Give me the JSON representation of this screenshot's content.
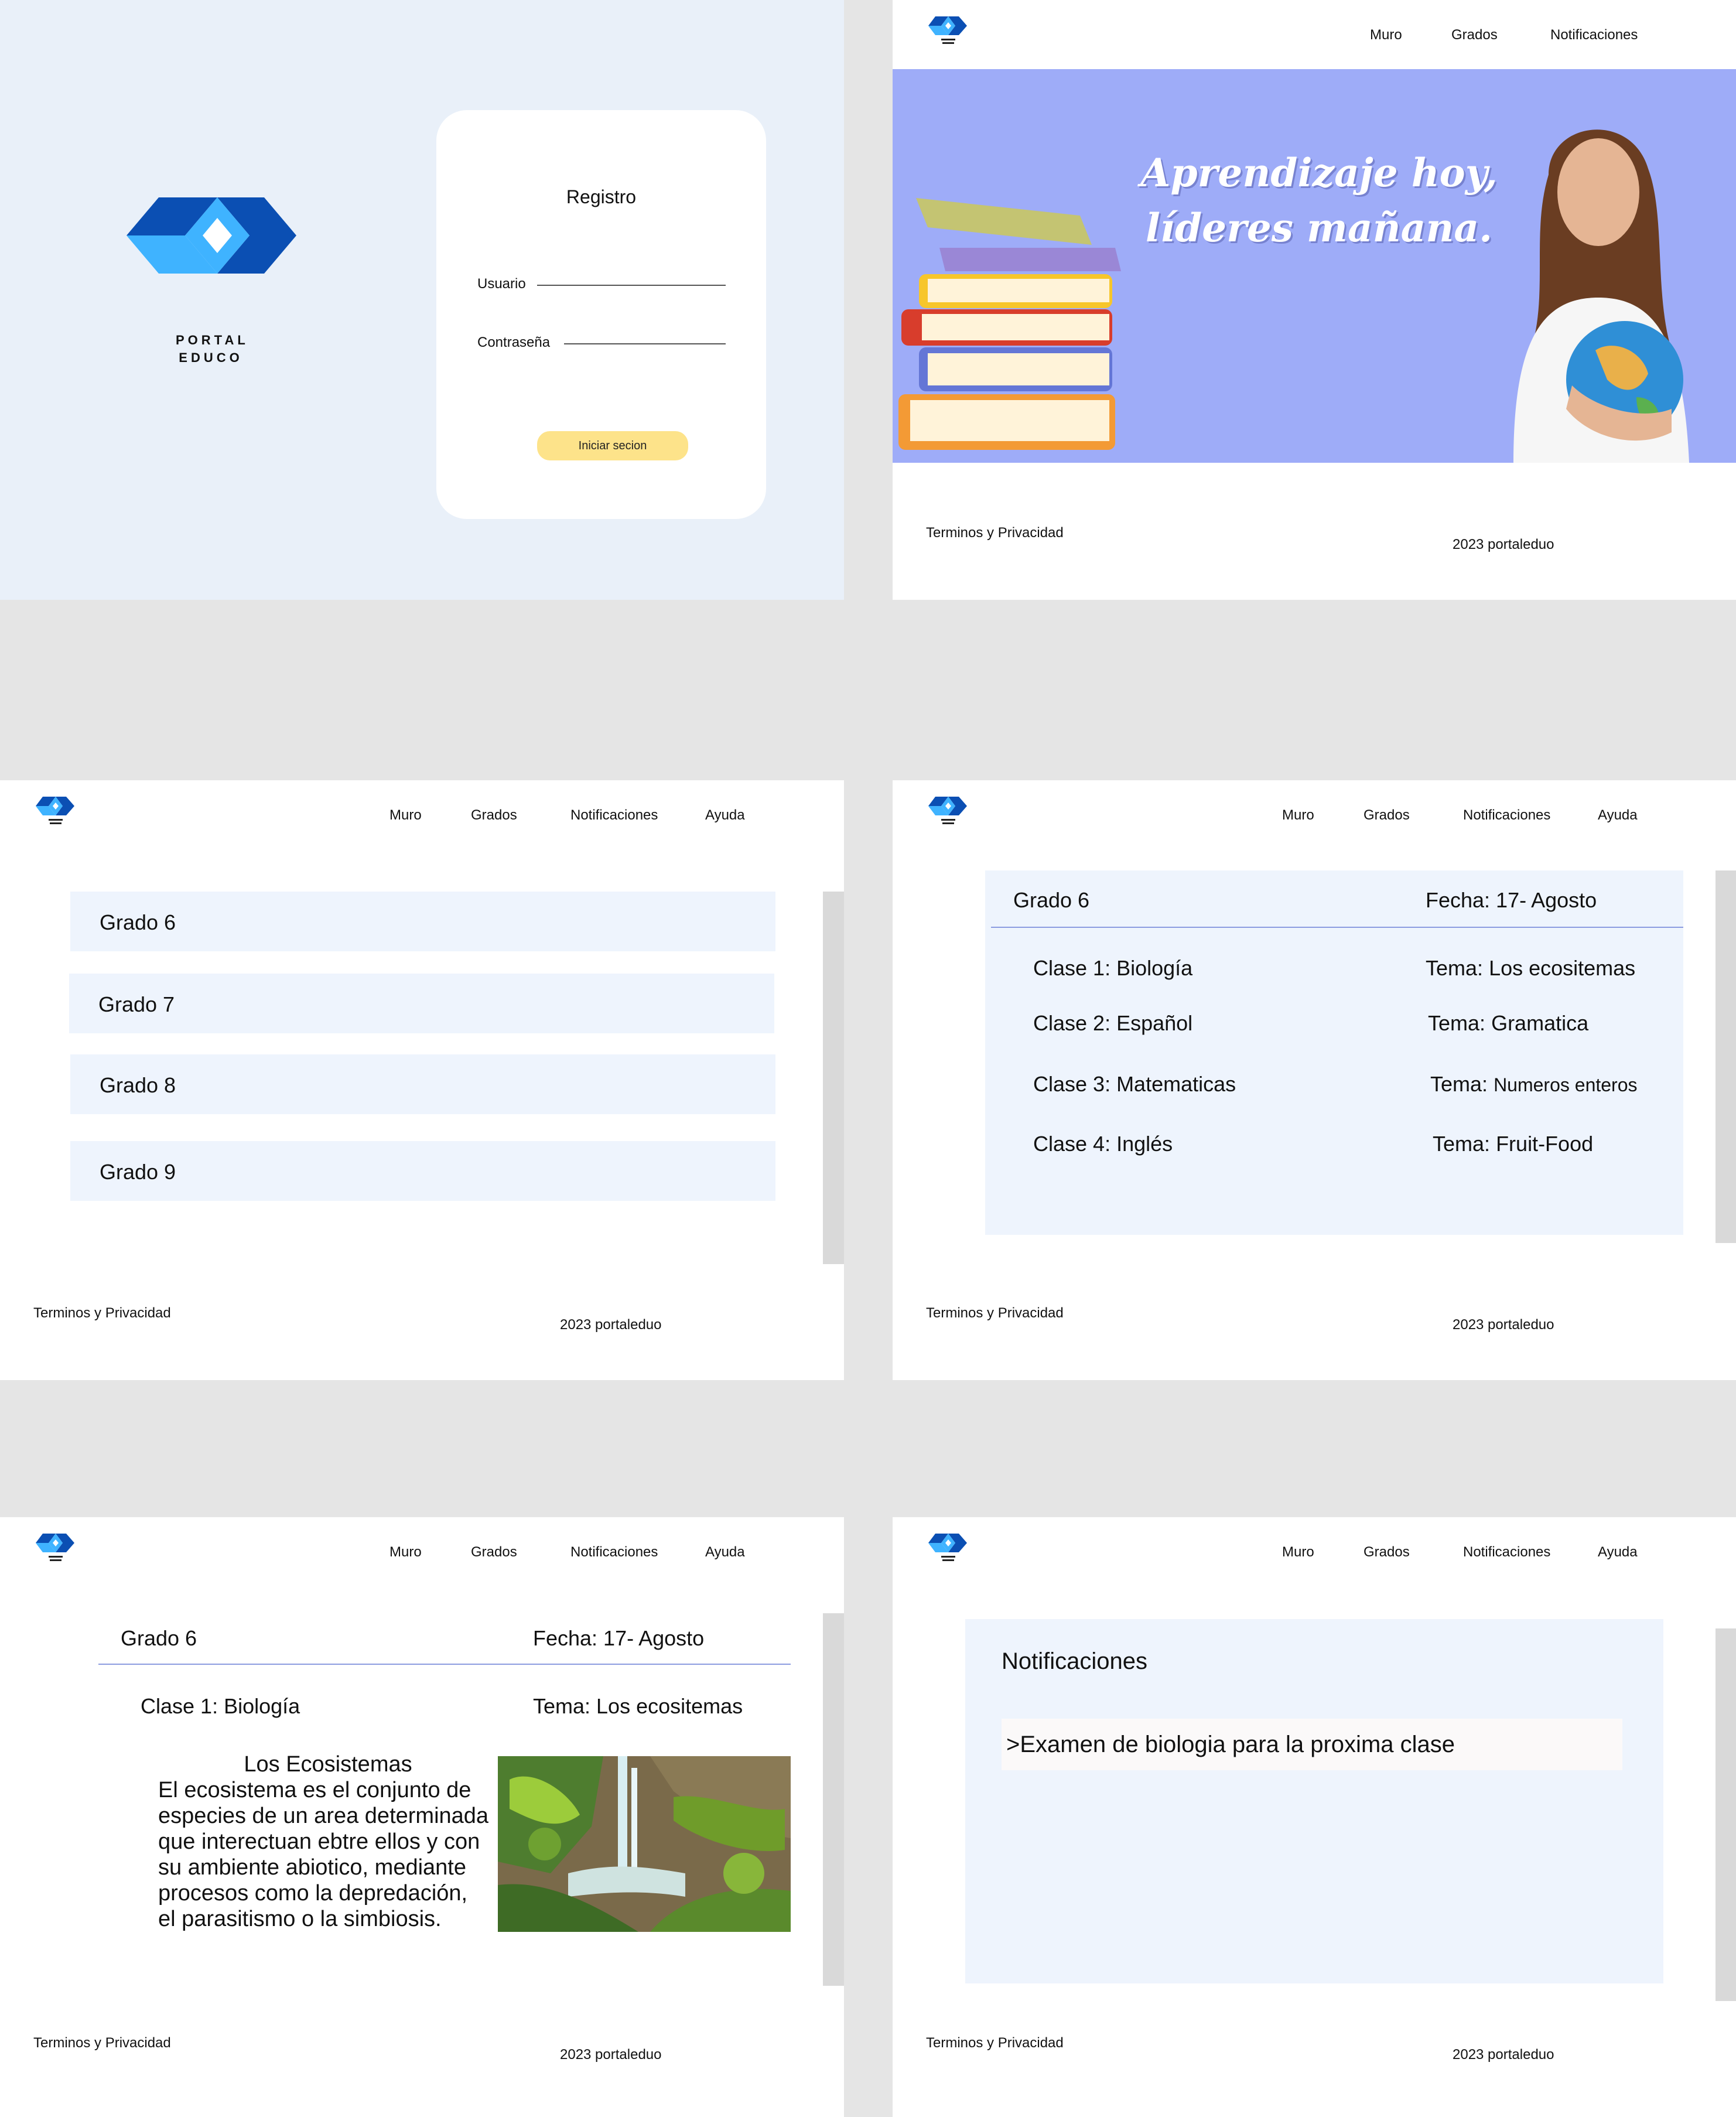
{
  "brand": {
    "name_line1": "PORTAL",
    "name_line2": "EDUCO",
    "logo_icon": "portal-educo-logo-icon",
    "primary": "#0b4fb3",
    "secondary": "#3fb3ff"
  },
  "login": {
    "title": "Registro",
    "username_label": "Usuario",
    "password_label": "Contraseña",
    "submit_label": "Iniciar secion"
  },
  "nav": {
    "muro": "Muro",
    "grados": "Grados",
    "notificaciones": "Notificaciones",
    "ayuda": "Ayuda"
  },
  "banner": {
    "line1": "Aprendizaje hoy,",
    "line2": "líderes mañana."
  },
  "footer": {
    "terms": "Terminos y Privacidad",
    "copyright": "2023 portaleduo"
  },
  "grades": [
    "Grado 6",
    "Grado 7",
    "Grado 8",
    "Grado 9"
  ],
  "grade_detail": {
    "grade": "Grado 6",
    "date": "Fecha: 17- Agosto",
    "classes": [
      {
        "name": "Clase 1: Biología",
        "topic_prefix": "Tema:",
        "topic": "Los ecositemas"
      },
      {
        "name": "Clase 2: Español",
        "topic_prefix": "Tema:",
        "topic": "Gramatica"
      },
      {
        "name": "Clase 3: Matematicas",
        "topic_prefix": "Tema:",
        "topic": "Numeros enteros"
      },
      {
        "name": "Clase 4: Inglés",
        "topic_prefix": "Tema:",
        "topic": "Fruit-Food"
      }
    ]
  },
  "lesson": {
    "grade": "Grado 6",
    "date": "Fecha: 17- Agosto",
    "class": "Clase 1: Biología",
    "topic": "Tema: Los ecositemas",
    "title": "Los Ecosistemas",
    "lines": [
      "El ecosistema es el conjunto de",
      "especies de un area determinada",
      "que interectuan ebtre ellos y con",
      "su ambiente abiotico, mediante",
      "procesos como la depredación,",
      "el parasitismo o la simbiosis."
    ]
  },
  "notifications": {
    "title": "Notificaciones",
    "items": [
      ">Examen de biologia para la proxima clase"
    ]
  }
}
